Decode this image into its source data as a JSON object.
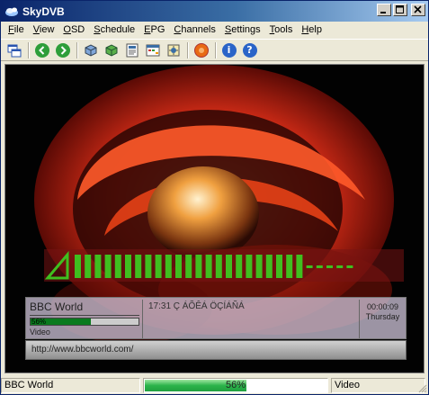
{
  "window": {
    "title": "SkyDVB"
  },
  "menu": [
    {
      "label": "File",
      "mnemonic": "F",
      "rest": "ile"
    },
    {
      "label": "View",
      "mnemonic": "V",
      "rest": "iew"
    },
    {
      "label": "OSD",
      "mnemonic": "O",
      "rest": "SD"
    },
    {
      "label": "Schedule",
      "mnemonic": "S",
      "rest": "chedule"
    },
    {
      "label": "EPG",
      "mnemonic": "E",
      "rest": "PG"
    },
    {
      "label": "Channels",
      "mnemonic": "C",
      "rest": "hannels"
    },
    {
      "label": "Settings",
      "mnemonic": "S",
      "rest": "ettings"
    },
    {
      "label": "Tools",
      "mnemonic": "T",
      "rest": "ools"
    },
    {
      "label": "Help",
      "mnemonic": "H",
      "rest": "elp"
    }
  ],
  "toolbar": {
    "icons": [
      "window-icon",
      "back-icon",
      "forward-icon",
      "channels-icon",
      "channel-list-icon",
      "epg-icon",
      "schedule-icon",
      "record-settings-icon",
      "record-icon",
      "info-icon",
      "help-icon"
    ]
  },
  "osd": {
    "channel": "BBC World",
    "signal_text": "56%",
    "signal_level": 0.56,
    "kind": "Video",
    "program": "17:31 Ç ÁÕÊÁ ÖÇÍÁÑÁ",
    "time": "00:00:09",
    "day": "Thursday",
    "url": "http://www.bbcworld.com/"
  },
  "volume": {
    "level": 0.82,
    "segments": 28
  },
  "status": {
    "channel": "BBC World",
    "progress_text": "56%",
    "progress_level": 0.56,
    "mode": "Video"
  },
  "colors": {
    "titlebar": "#0a246a",
    "volume_green": "#3fbf1f",
    "progress_green": "#2bb34a"
  }
}
